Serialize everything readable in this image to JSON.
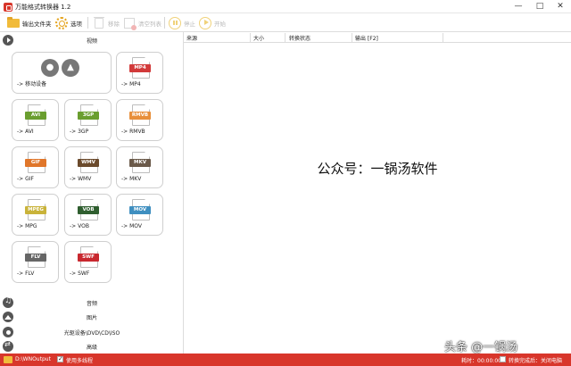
{
  "app": {
    "title": "万能格式转换器 1.2"
  },
  "window_controls": {
    "minimize": "—",
    "maximize": "□",
    "close": "✕"
  },
  "toolbar": {
    "output_folder": "输出文件夹",
    "options": "选项",
    "remove": "移除",
    "clear_list": "清空列表",
    "stop": "停止",
    "start": "开始"
  },
  "categories": {
    "video": "视频",
    "music": "音频",
    "image": "图片",
    "disc": "光驱设备\\DVD\\CD\\ISO",
    "advanced": "高级"
  },
  "tiles": [
    {
      "name": "mobile",
      "label": "-> 移动设备"
    },
    {
      "name": "mp4",
      "badge": "MP4",
      "label": "-> MP4",
      "color": "#d23a3a"
    },
    {
      "name": "avi",
      "badge": "AVI",
      "label": "-> AVI",
      "color": "#6a9e2f"
    },
    {
      "name": "3gp",
      "badge": "3GP",
      "label": "-> 3GP",
      "color": "#6a9e2f"
    },
    {
      "name": "rmvb",
      "badge": "RMVB",
      "label": "-> RMVB",
      "color": "#e88f3a"
    },
    {
      "name": "gif",
      "badge": "GIF",
      "label": "-> GIF",
      "color": "#e0762a"
    },
    {
      "name": "wmv",
      "badge": "WMV",
      "label": "-> WMV",
      "color": "#6b4a2c"
    },
    {
      "name": "mkv",
      "badge": "MKV",
      "label": "-> MKV",
      "color": "#6b5a4a"
    },
    {
      "name": "mpg",
      "badge": "MPEG",
      "label": "-> MPG",
      "color": "#c9b33a"
    },
    {
      "name": "vob",
      "badge": "VOB",
      "label": "-> VOB",
      "color": "#2f5e2f"
    },
    {
      "name": "mov",
      "badge": "MOV",
      "label": "-> MOV",
      "color": "#3f8fc0"
    },
    {
      "name": "flv",
      "badge": "FLV",
      "label": "-> FLV",
      "color": "#666666"
    },
    {
      "name": "swf",
      "badge": "SWF",
      "label": "-> SWF",
      "color": "#c8282f"
    }
  ],
  "list_columns": {
    "source": "来源",
    "size": "大小",
    "status": "转换状态",
    "output": "输出 [F2]"
  },
  "watermark": "公众号：一锅汤软件",
  "corner_watermark": "头条 @一锅汤",
  "statusbar": {
    "output_path": "D:\\WNOutput",
    "multithread_label": "使用多线程",
    "elapsed": "耗时：00:00:00",
    "after_convert": "转换完成后：关闭电脑"
  },
  "colors": {
    "accent": "#d8362b",
    "folder": "#f1bb3a"
  }
}
